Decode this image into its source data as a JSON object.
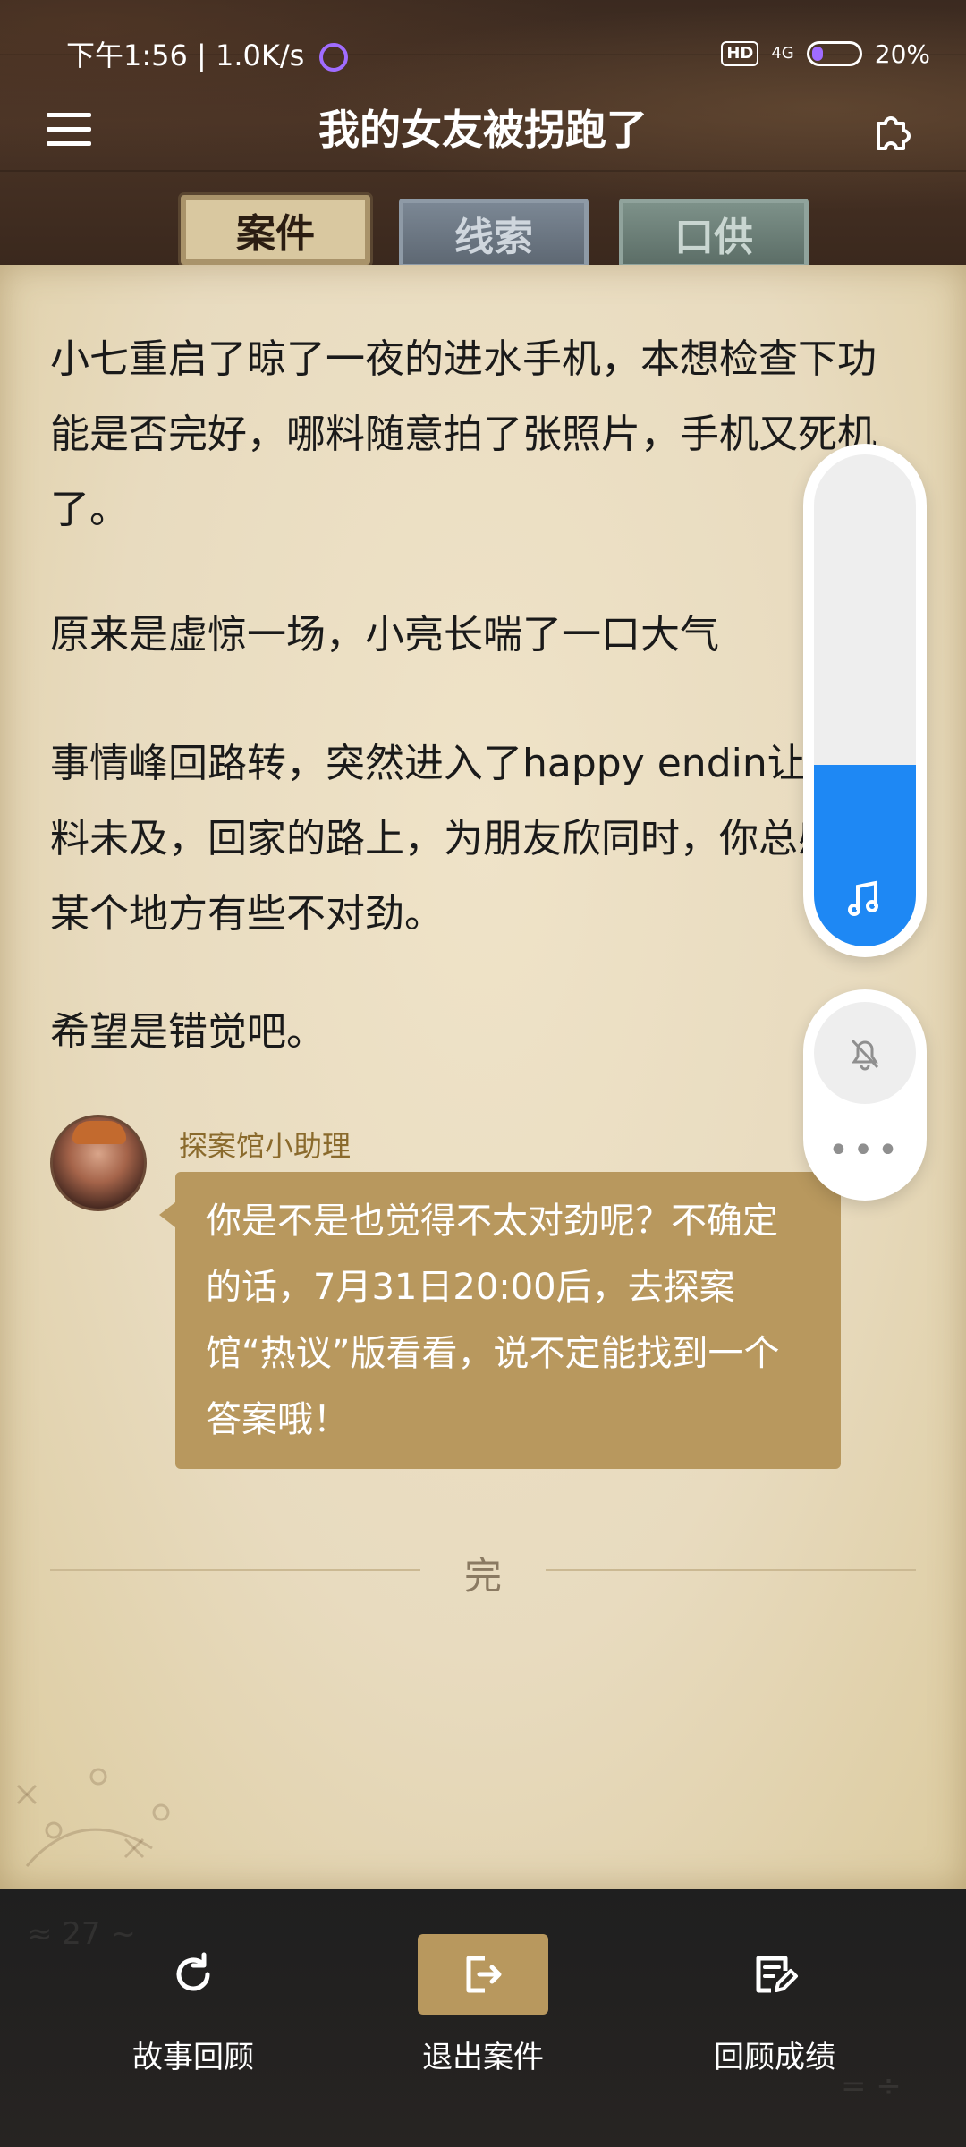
{
  "status_bar": {
    "time": "下午1:56 | 1.0K/s",
    "hd": "HD",
    "network": "4G",
    "battery": "20%"
  },
  "header": {
    "title": "我的女友被拐跑了",
    "icons": {
      "menu": "menu-icon",
      "right": "puzzle-icon"
    }
  },
  "tabs": [
    {
      "label": "案件",
      "active": true
    },
    {
      "label": "线索",
      "active": false
    },
    {
      "label": "口供",
      "active": false
    }
  ],
  "story": {
    "paragraph1": "小七重启了晾了一夜的进水手机，本想检查下功能是否完好，哪料随意拍了张照片，手机又死机了。",
    "paragraph2": "原来是虚惊一场，小亮长喘了一口大气",
    "paragraph3": "事情峰回路转，突然进入了happy endin让你始料未及，回家的路上，为朋友欣同时，你总感觉某个地方有些不对劲。",
    "paragraph4": "希望是错觉吧。"
  },
  "assistant": {
    "name": "探案馆小助理",
    "message": "你是不是也觉得不太对劲呢？不确定的话，7月31日20:00后，去探案馆“热议”版看看，说不定能找到一个答案哦！"
  },
  "end_marker": "完",
  "floating_controls": {
    "volume_level": 0.37,
    "music_icon": "music-note-icon",
    "bell_icon": "bell-off-icon",
    "more_label": "•••",
    "accent_color": "#1e88f4"
  },
  "bottom_nav": {
    "items": [
      {
        "label": "故事回顾",
        "icon": "refresh-icon"
      },
      {
        "label": "退出案件",
        "icon": "exit-icon"
      },
      {
        "label": "回顾成绩",
        "icon": "edit-document-icon"
      }
    ]
  }
}
